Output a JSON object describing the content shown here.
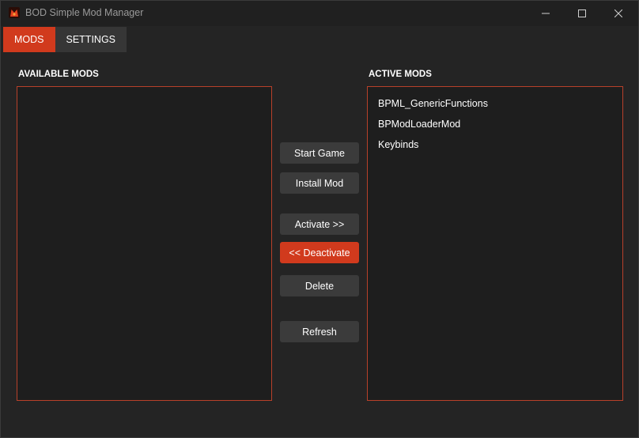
{
  "window": {
    "title": "BOD Simple Mod Manager",
    "icon": "app-logo-icon"
  },
  "tabs": [
    {
      "label": "MODS",
      "active": true
    },
    {
      "label": "SETTINGS",
      "active": false
    }
  ],
  "available_mods": {
    "label": "AVAILABLE MODS",
    "items": []
  },
  "active_mods": {
    "label": "ACTIVE MODS",
    "items": [
      "BPML_GenericFunctions",
      "BPModLoaderMod",
      "Keybinds"
    ]
  },
  "actions": {
    "start_game": "Start Game",
    "install_mod": "Install Mod",
    "activate": "Activate >>",
    "deactivate": "<< Deactivate",
    "delete": "Delete",
    "refresh": "Refresh"
  },
  "colors": {
    "accent": "#d13a1d",
    "list_border": "#b8402a",
    "background": "#242424",
    "button": "#3b3b3b"
  }
}
